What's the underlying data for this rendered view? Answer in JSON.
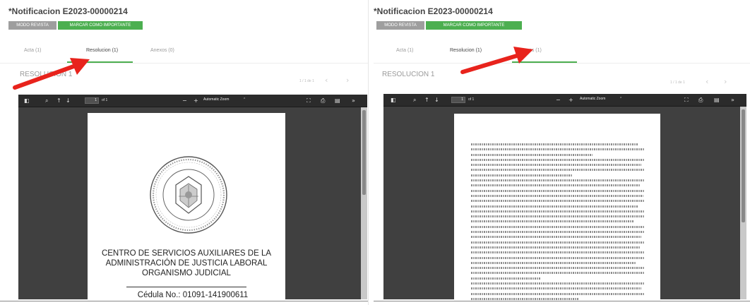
{
  "left": {
    "title": "*Notificacion E2023-00000214",
    "buttons": {
      "modo_revista": "MODO REVISTA",
      "marcar_importante": "MARCAR COMO IMPORTANTE"
    },
    "tabs": [
      {
        "label": "Acta (1)",
        "active": false
      },
      {
        "label": "Resolucion (1)",
        "active": true
      },
      {
        "label": "Anexos (0)",
        "active": false
      }
    ],
    "section_label": "RESOLUCION 1",
    "pager": "1 / 1 de 1",
    "viewer": {
      "page_number": "1",
      "page_total": "of 1",
      "zoom": "Automatic Zoom",
      "document": {
        "line1": "CENTRO DE SERVICIOS AUXILIARES DE LA",
        "line2": "ADMINISTRACIÓN DE JUSTICIA LABORAL",
        "line3": "ORGANISMO JUDICIAL",
        "cedula": "Cédula No.: 01091-141900611"
      }
    }
  },
  "right": {
    "title": "*Notificacion E2023-00000214",
    "buttons": {
      "modo_revista": "MODO REVISTA",
      "marcar_importante": "MARCAR COMO IMPORTANTE"
    },
    "tabs": [
      {
        "label": "Acta (1)",
        "active": false
      },
      {
        "label": "Resolucion (1)",
        "active": true
      },
      {
        "label": "Anexos (1)",
        "active": false
      }
    ],
    "section_label": "RESOLUCION 1",
    "pager": "1 / 1 de 1",
    "viewer": {
      "page_number": "1",
      "page_total": "of 1",
      "zoom": "Automatic Zoom"
    }
  },
  "colors": {
    "accent_green": "#4caf50",
    "button_gray": "#9e9e9e",
    "annotation_red": "#e8231c",
    "viewer_bg": "#404040",
    "toolbar_bg": "#2b2b2b"
  },
  "icons": [
    "sidebar-toggle-icon",
    "search-icon",
    "page-up-icon",
    "page-down-icon",
    "zoom-out-icon",
    "zoom-in-icon",
    "presentation-mode-icon",
    "print-icon",
    "download-icon",
    "more-tools-icon",
    "chevron-left-icon",
    "chevron-right-icon",
    "red-arrow-icon"
  ]
}
